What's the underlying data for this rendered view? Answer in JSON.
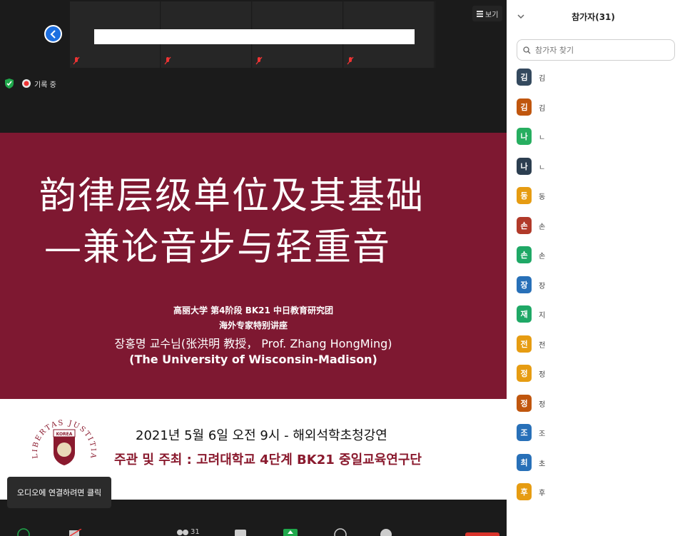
{
  "meeting": {
    "view_label": "보기",
    "recording_label": "기록 중",
    "audio_tooltip": "오디오에 연결하려면 클릭",
    "participant_count": "31"
  },
  "slide": {
    "title_line1": "韵律层级单位及其基础",
    "title_line2": "—兼论音步与轻重音",
    "subtitle1": "高丽大学 第4阶段 BK21 中日教育研究团",
    "subtitle2": "海外专家特别讲座",
    "presenter": "장홍명 교수님(张洪明 教授，  Prof. Zhang HongMing)",
    "affiliation": "(The University of Wisconsin-Madison)",
    "date_line": "2021년 5월 6일 오전 9시 - 해외석학초청강연",
    "host_prefix": "주관 및 주최 : ",
    "host_name": "고려대학교 4단계 BK21 중일교육연구단",
    "seal_text": "LIBERTAS JUSTITIA VERITAS",
    "seal_name": "KOREA"
  },
  "panel": {
    "title": "참가자(31)",
    "search_placeholder": "참가자 찾기",
    "participants": [
      {
        "initial": "김",
        "name": "김",
        "color": "#34495e"
      },
      {
        "initial": "김",
        "name": "김",
        "color": "#c0560e"
      },
      {
        "initial": "나",
        "name": "ㄴ",
        "color": "#27ae60"
      },
      {
        "initial": "나",
        "name": "ㄴ",
        "color": "#2c3e50"
      },
      {
        "initial": "동",
        "name": "동",
        "color": "#e69c12"
      },
      {
        "initial": "손",
        "name": "손",
        "color": "#b13a2a"
      },
      {
        "initial": "손",
        "name": "손",
        "color": "#1fa866"
      },
      {
        "initial": "장",
        "name": "장",
        "color": "#2870b8"
      },
      {
        "initial": "재",
        "name": "지",
        "color": "#1fa866"
      },
      {
        "initial": "전",
        "name": "전",
        "color": "#e69c12"
      },
      {
        "initial": "정",
        "name": "정",
        "color": "#e69c12"
      },
      {
        "initial": "정",
        "name": "정",
        "color": "#c0560e"
      },
      {
        "initial": "조",
        "name": "조",
        "color": "#2870b8"
      },
      {
        "initial": "최",
        "name": "초",
        "color": "#2870b8"
      },
      {
        "initial": "후",
        "name": "후",
        "color": "#e69c12"
      }
    ]
  }
}
